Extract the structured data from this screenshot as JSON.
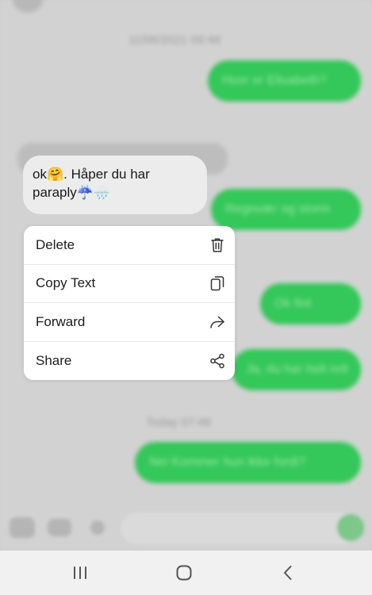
{
  "background_chat": {
    "timestamp_top": "11/06/2021 09:48",
    "timestamp_mid": "Today 07:48",
    "outgoing_messages": [
      "Hvor er Elisabeth?",
      "Regnvær og storm",
      "Ok fint",
      "Ja, du har helt rett",
      "Nei Kommer hun ikke fordi?"
    ]
  },
  "focused_message": {
    "text": "ok🤗. Håper du har paraply☔🌧️"
  },
  "context_menu": {
    "items": [
      {
        "label": "Delete",
        "icon": "trash-icon"
      },
      {
        "label": "Copy Text",
        "icon": "copy-icon"
      },
      {
        "label": "Forward",
        "icon": "forward-icon"
      },
      {
        "label": "Share",
        "icon": "share-icon"
      }
    ]
  },
  "nav_bar": {
    "recents_icon": "recents-icon",
    "home_icon": "home-icon",
    "back_icon": "back-icon"
  },
  "colors": {
    "outgoing_bubble": "#34c759",
    "menu_background": "#ffffff",
    "incoming_bubble": "#ececec"
  }
}
